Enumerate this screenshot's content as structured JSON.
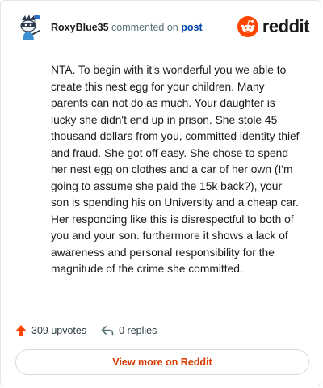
{
  "comment": {
    "username": "RoxyBlue35",
    "action_text": "commented on",
    "post_link": "post",
    "avatar_icon": "avatar-snoo-icon",
    "body": "NTA. To begin with it's wonderful you we able to create this nest egg for your children. Many parents can not do as much. Your daughter is lucky she didn't end up in prison. She stole 45 thousand dollars from you, committed identity thief and fraud. She got off easy. She chose to spend her nest egg on clothes and a car of her own (I'm going to assume she paid the 15k back?), your son is spending his on University and a cheap car. Her responding like this is disrespectful to both of you and your son. furthermore it shows a lack of awareness and personal responsibility for the magnitude of the crime she committed."
  },
  "brand": {
    "name": "reddit",
    "icon": "reddit-logo-icon",
    "color": "#ff4500"
  },
  "stats": {
    "upvotes": "309 upvotes",
    "replies": "0 replies",
    "upvote_icon": "upvote-arrow-icon",
    "reply_icon": "reply-arrow-icon",
    "upvote_color": "#ff4500"
  },
  "footer": {
    "view_more_label": "View more on Reddit",
    "accent_color": "#d93a00"
  }
}
